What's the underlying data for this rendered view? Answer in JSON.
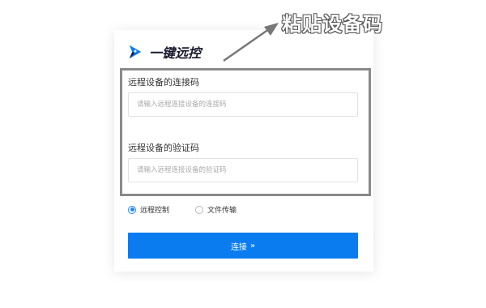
{
  "annotation": {
    "text": "粘贴设备码"
  },
  "brand": {
    "name": "一键远控",
    "icon": "rocket-play-icon",
    "colors": {
      "primary": "#0a7cf0",
      "dark": "#1a1a2e"
    }
  },
  "form": {
    "code_label": "远程设备的连接码",
    "code_placeholder": "请输入远程连接设备的连接码",
    "verify_label": "远程设备的验证码",
    "verify_placeholder": "请输入远程连接设备的验证码"
  },
  "options": {
    "remote_control": {
      "label": "远程控制",
      "checked": true
    },
    "file_transfer": {
      "label": "文件传输",
      "checked": false
    }
  },
  "connect_button": {
    "label": "连接",
    "icon": "double-chevron-right-icon"
  }
}
